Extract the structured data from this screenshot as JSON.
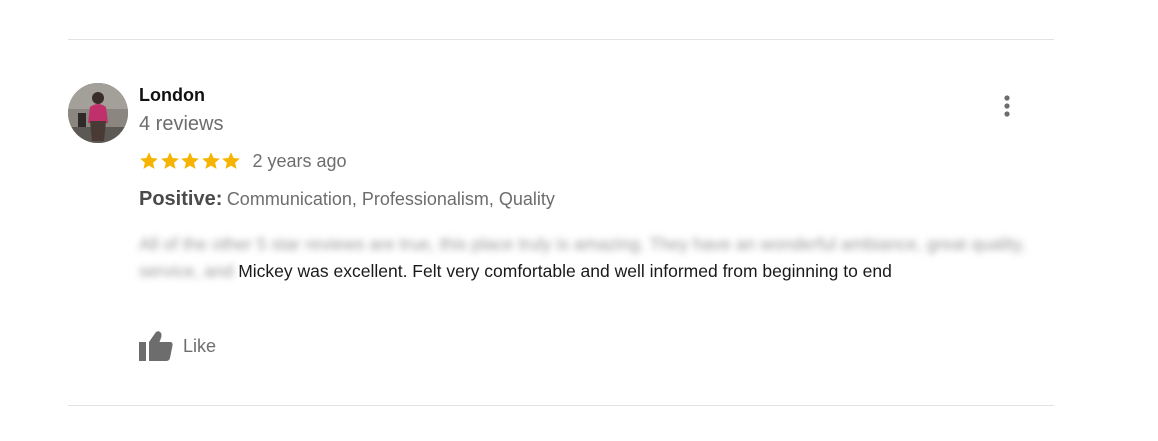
{
  "review": {
    "reviewer_name": "London",
    "reviews_count": "4 reviews",
    "rating": 5,
    "rating_max": 5,
    "time_ago": "2 years ago",
    "positive_label": "Positive:",
    "positive_values": "Communication, Professionalism, Quality",
    "text_blurred": "All of the other 5 star reviews are true, this place truly is amazing. They have an wonderful ambiance, great quality, service, and",
    "text_visible": " Mickey was excellent. Felt very comfortable and well informed from beginning to end",
    "like_label": "Like"
  },
  "colors": {
    "star": "#f6b400",
    "divider": "#e3e3e3",
    "icon": "#6d6d6d"
  },
  "icons": {
    "avatar": "avatar-photo",
    "more": "more-vertical-icon",
    "like": "thumbs-up-icon",
    "star": "star-icon"
  }
}
